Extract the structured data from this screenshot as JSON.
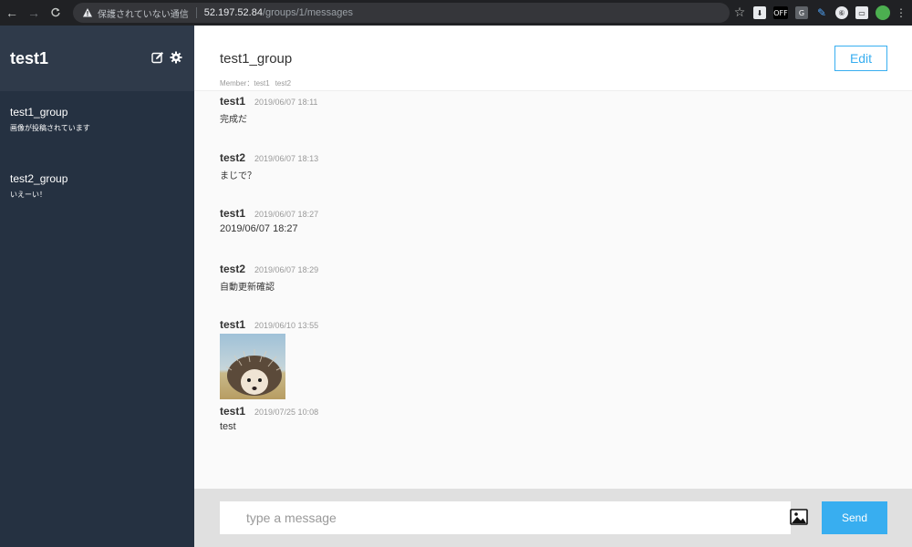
{
  "browser": {
    "insecure_label": "保護されていない通信",
    "url_host": "52.197.52.84",
    "url_path": "/groups/1/messages",
    "ext_off_label": "OFF",
    "ext_g_label": "G",
    "ext_circle_label": "⑥"
  },
  "sidebar": {
    "user_name": "test1",
    "groups": [
      {
        "name": "test1_group",
        "last_message": "画像が投稿されています"
      },
      {
        "name": "test2_group",
        "last_message": "いえーい！"
      }
    ]
  },
  "main": {
    "group_title": "test1_group",
    "members_label": "Member：",
    "members": [
      "test1",
      "test2"
    ],
    "edit_label": "Edit",
    "messages": [
      {
        "user": "test1",
        "date": "2019/06/07 18:11",
        "text": "完成だ"
      },
      {
        "user": "test2",
        "date": "2019/06/07 18:13",
        "text": "まじで？"
      },
      {
        "user": "test1",
        "date": "2019/06/07 18:27",
        "text": "2019/06/07 18:27"
      },
      {
        "user": "test2",
        "date": "2019/06/07 18:29",
        "text": "自動更新確認"
      },
      {
        "user": "test1",
        "date": "2019/06/10 13:55",
        "image": "hedgehog-photo"
      },
      {
        "user": "test1",
        "date": "2019/07/25 10:08",
        "text": "test"
      }
    ],
    "input_placeholder": "type a message",
    "send_label": "Send"
  },
  "colors": {
    "sidebar_bg": "#253141",
    "sidebar_header_bg": "#2f3a4a",
    "accent": "#38aef0",
    "footer_bg": "#e0e0e0"
  }
}
